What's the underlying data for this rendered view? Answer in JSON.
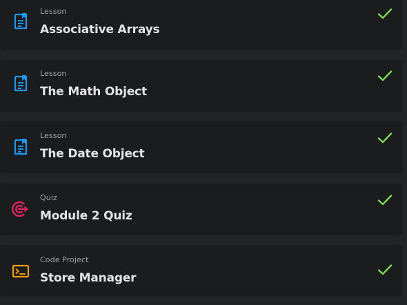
{
  "colors": {
    "background": "#232426",
    "card": "#1b1c1e",
    "lesson_icon": "#2196f3",
    "quiz_icon": "#e0245e",
    "project_icon": "#f39c12",
    "check": "#7ed957",
    "title_text": "#e3e3e3",
    "kind_text": "#a3a3a3"
  },
  "items": [
    {
      "type": "Lesson",
      "title": "Associative Arrays",
      "icon": "lesson-document-icon",
      "completed": true
    },
    {
      "type": "Lesson",
      "title": "The Math Object",
      "icon": "lesson-document-icon",
      "completed": true
    },
    {
      "type": "Lesson",
      "title": "The Date Object",
      "icon": "lesson-document-icon",
      "completed": true
    },
    {
      "type": "Quiz",
      "title": "Module 2 Quiz",
      "icon": "quiz-target-icon",
      "completed": true
    },
    {
      "type": "Code Project",
      "title": "Store Manager",
      "icon": "code-project-terminal-icon",
      "completed": true
    }
  ]
}
